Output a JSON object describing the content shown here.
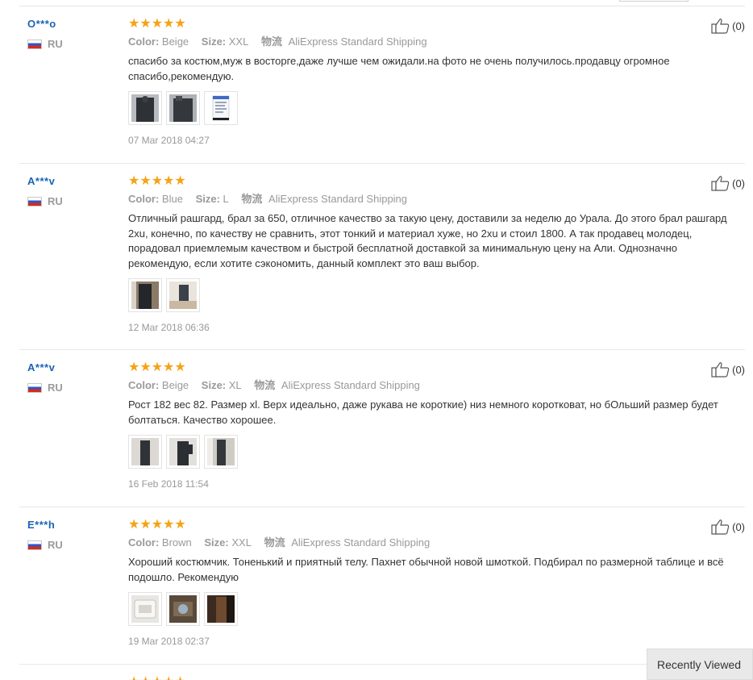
{
  "labels": {
    "color": "Color:",
    "size": "Size:",
    "logistics": "物流"
  },
  "recently_viewed": "Recently Viewed",
  "reviews": [
    {
      "user": "O***o",
      "country": "RU",
      "rating": 5,
      "color": "Beige",
      "size": "XXL",
      "shipping": "AliExpress Standard Shipping",
      "text": "спасибо за костюм,муж в восторге,даже лучше чем ожидали.на фото не очень получилось.продавцу огромное спасибо,рекомендую.",
      "date": "07 Mar 2018 04:27",
      "helpful": "(0)",
      "thumbs": [
        "dark-suit-photo",
        "dark-suit-photo",
        "phone-screenshot"
      ]
    },
    {
      "user": "A***v",
      "country": "RU",
      "rating": 5,
      "color": "Blue",
      "size": "L",
      "shipping": "AliExpress Standard Shipping",
      "text": "Отличный рашгард, брал за 650, отличное качество за такую цену, доставили за неделю до Урала. До этого брал рашгард 2хu, конечно, по качеству не сравнить, этот тонкий и материал хуже, но 2хu и стоил 1800. А так продавец молодец, порадовал приемлемым качеством и быстрой бесплатной доставкой за минимальную цену на Али. Однозначно рекомендую, если хотите сэкономить, данный комплект это ваш выбор.",
      "date": "12 Mar 2018 06:36",
      "helpful": "(0)",
      "thumbs": [
        "dark-suit-photo",
        "dark-suit-photo"
      ]
    },
    {
      "user": "A***v",
      "country": "RU",
      "rating": 5,
      "color": "Beige",
      "size": "XL",
      "shipping": "AliExpress Standard Shipping",
      "text": "Рост 182 вес 82. Размер xl. Верх идеально, даже рукава не короткие) низ немного коротковат, но бОльший размер будет болтаться. Качество хорошее.",
      "date": "16 Feb 2018 11:54",
      "helpful": "(0)",
      "thumbs": [
        "dark-suit-photo",
        "dark-suit-photo",
        "dark-suit-photo"
      ]
    },
    {
      "user": "E***h",
      "country": "RU",
      "rating": 5,
      "color": "Brown",
      "size": "XXL",
      "shipping": "AliExpress Standard Shipping",
      "text": "Хороший костюмчик. Тоненький и приятный телу. Пахнет обычной новой шмоткой. Подбирал по размерной таблице и всё подошло. Рекомендую",
      "date": "19 Mar 2018 02:37",
      "helpful": "(0)",
      "thumbs": [
        "package-photo",
        "package-photo-dark",
        "brown-suit-photo"
      ]
    },
    {
      "user": "",
      "country": "",
      "rating": 5,
      "color": "",
      "size": "",
      "shipping": "",
      "text": "",
      "date": "",
      "helpful": "",
      "thumbs": []
    }
  ]
}
